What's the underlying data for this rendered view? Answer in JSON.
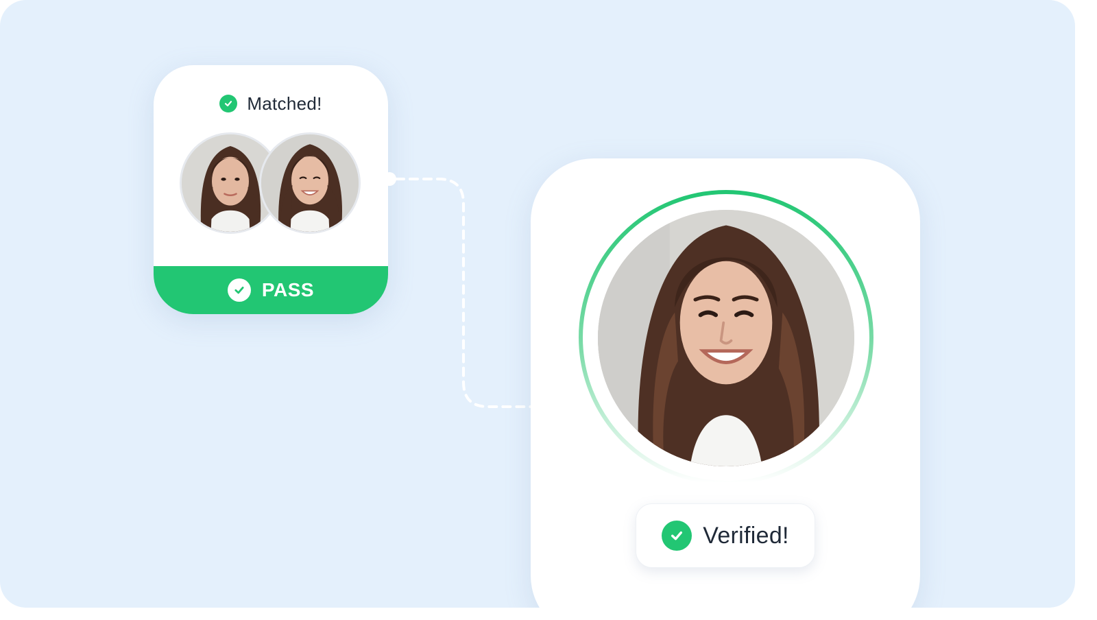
{
  "match_card": {
    "status_label": "Matched!",
    "result_label": "PASS"
  },
  "verify_card": {
    "status_label": "Verified!"
  },
  "colors": {
    "background": "#e4f0fc",
    "success_green": "#22c673",
    "card": "#ffffff",
    "text": "#1f2937"
  },
  "icons": {
    "matched": "check-circle-icon",
    "pass": "check-circle-icon",
    "verified": "check-circle-icon"
  }
}
